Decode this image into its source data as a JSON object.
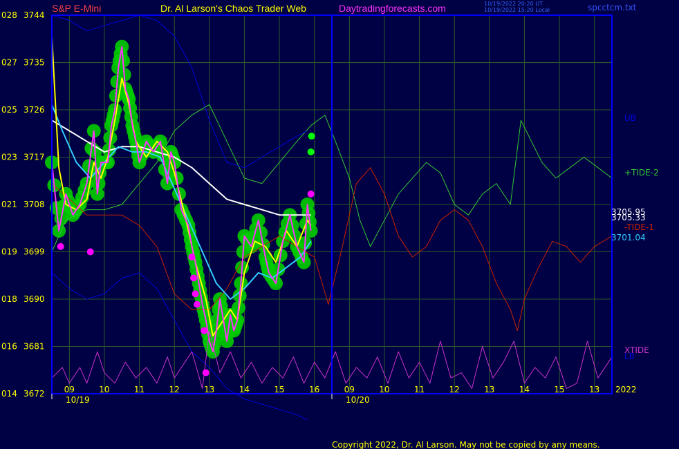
{
  "header": {
    "instrument": "S&P E-Mini",
    "site": "Dr. Al Larson's Chaos Trader Web",
    "url": "Daytradingforecasts.com",
    "timestamp_ut": "10/19/2022 20:20 UT",
    "timestamp_local": "10/19/2022 15:20 Local",
    "file": "spcctcm.txt"
  },
  "copyright": "Copyright 2022, Dr. Al Larson. May not be copied by any means.",
  "colors": {
    "background": "#000044",
    "plot_border": "#0000FF",
    "grid": "#2B5A2B",
    "price": "#FF33FF",
    "ma_fast": "#FFFF00",
    "ma_mid": "#33CCFF",
    "ma_slow": "#FFFFFF",
    "tide_plus": "#33CC33",
    "tide_minus": "#CC2200",
    "bands": "#0000DD",
    "xtide": "#CC33CC",
    "bubble": "#00CC00"
  },
  "chart_data": {
    "type": "line",
    "title": "S&P E-Mini",
    "y_ticks": [
      {
        "left": "028",
        "right": "3744"
      },
      {
        "left": "027",
        "right": "3735"
      },
      {
        "left": "025",
        "right": "3726"
      },
      {
        "left": "023",
        "right": "3717"
      },
      {
        "left": "021",
        "right": "3708"
      },
      {
        "left": "019",
        "right": "3699"
      },
      {
        "left": "018",
        "right": "3690"
      },
      {
        "left": "016",
        "right": "3681"
      },
      {
        "left": "014",
        "right": "3672"
      }
    ],
    "ylim": [
      3672,
      3744
    ],
    "x_hour_labels": [
      "09",
      "10",
      "11",
      "12",
      "13",
      "14",
      "15",
      "16",
      "09",
      "10",
      "11",
      "12",
      "13",
      "14",
      "15",
      "13"
    ],
    "x_date_labels": [
      {
        "label": "10/19",
        "hour": 8.5
      },
      {
        "label": "10/20",
        "hour": 16.5
      }
    ],
    "year_label": "2022",
    "xlim": [
      8.5,
      24.5
    ],
    "grid": true,
    "series": [
      {
        "name": "+TIDE-2",
        "color": "#33CC33",
        "x": [
          8.5,
          8.9,
          9.5,
          10.0,
          10.5,
          11.0,
          11.5,
          12.0,
          12.5,
          13.0,
          13.5,
          14.0,
          14.5,
          15.0,
          15.5,
          15.9,
          16.3,
          16.6,
          17.0,
          17.3,
          17.6,
          18.0,
          18.4,
          18.8,
          19.2,
          19.6,
          20.0,
          20.4,
          20.8,
          21.2,
          21.6,
          21.9,
          22.2,
          22.5,
          22.9,
          23.3,
          23.7,
          24.1,
          24.5
        ],
        "y": [
          3699,
          3705,
          3707,
          3707,
          3708,
          3712,
          3716,
          3722,
          3725,
          3727,
          3720,
          3713,
          3712,
          3716,
          3720,
          3723,
          3725,
          3720,
          3713,
          3705,
          3700,
          3705,
          3710,
          3713,
          3716,
          3714,
          3708,
          3706,
          3710,
          3712,
          3708,
          3724,
          3720,
          3716,
          3713,
          3715,
          3717,
          3715,
          3713
        ]
      },
      {
        "name": "-TIDE-1",
        "color": "#CC2200",
        "x": [
          8.5,
          9.0,
          9.5,
          10.0,
          10.5,
          11.0,
          11.5,
          12.0,
          12.5,
          13.0,
          13.5,
          14.0,
          14.5,
          15.0,
          15.5,
          16.0,
          16.4,
          16.8,
          17.2,
          17.6,
          18.0,
          18.4,
          18.8,
          19.2,
          19.6,
          20.0,
          20.4,
          20.8,
          21.2,
          21.6,
          21.8,
          22.0,
          22.4,
          22.8,
          23.2,
          23.6,
          24.0,
          24.5
        ],
        "y": [
          3712,
          3709,
          3706,
          3706,
          3706,
          3704,
          3700,
          3691,
          3688,
          3688,
          3692,
          3698,
          3700,
          3702,
          3700,
          3698,
          3689,
          3700,
          3712,
          3715,
          3710,
          3702,
          3698,
          3700,
          3705,
          3707,
          3705,
          3700,
          3693,
          3688,
          3684,
          3690,
          3696,
          3701,
          3700,
          3697,
          3700,
          3702
        ]
      },
      {
        "name": "UB",
        "color": "#0000DD",
        "x": [
          8.5,
          9.0,
          9.5,
          10.0,
          10.5,
          11.0,
          11.5,
          12.0,
          12.5,
          13.0,
          13.5,
          14.0,
          14.5,
          15.0,
          15.5,
          15.8
        ],
        "y": [
          3744,
          3743,
          3741,
          3742,
          3743,
          3744,
          3743,
          3740,
          3734,
          3724,
          3716,
          3715,
          3717,
          3719,
          3721,
          3722
        ]
      },
      {
        "name": "LB",
        "color": "#0000DD",
        "x": [
          8.5,
          9.0,
          9.5,
          10.0,
          10.5,
          11.0,
          11.5,
          12.0,
          12.5,
          13.0,
          13.5,
          14.0,
          14.5,
          15.0,
          15.5,
          15.8
        ],
        "y": [
          3695,
          3692,
          3690,
          3691,
          3694,
          3695,
          3692,
          3686,
          3680,
          3677,
          3673,
          3671,
          3670,
          3669,
          3668,
          3667
        ]
      },
      {
        "name": "3705.95",
        "color": "#FFFFFF",
        "x": [
          8.5,
          9.0,
          9.5,
          10.0,
          10.5,
          11.0,
          11.5,
          12.0,
          12.5,
          13.0,
          13.5,
          14.0,
          14.5,
          15.0,
          15.5,
          15.9
        ],
        "y": [
          3724,
          3722,
          3720,
          3718,
          3719,
          3719,
          3718,
          3717,
          3715,
          3712,
          3709,
          3708,
          3707,
          3706,
          3706,
          3706
        ]
      },
      {
        "name": "3701.04",
        "color": "#33CCFF",
        "x": [
          8.5,
          8.8,
          9.2,
          9.6,
          10.0,
          10.4,
          10.8,
          11.2,
          11.6,
          12.0,
          12.4,
          12.8,
          13.2,
          13.6,
          14.0,
          14.4,
          14.8,
          15.2,
          15.6,
          15.9
        ],
        "y": [
          3727,
          3722,
          3716,
          3713,
          3716,
          3719,
          3718,
          3718,
          3717,
          3711,
          3705,
          3699,
          3693,
          3690,
          3692,
          3695,
          3694,
          3696,
          3698,
          3701
        ]
      },
      {
        "name": "Fast MA",
        "color": "#FFFF00",
        "x": [
          8.5,
          8.7,
          8.9,
          9.2,
          9.5,
          9.7,
          9.9,
          10.1,
          10.3,
          10.5,
          10.7,
          10.9,
          11.2,
          11.5,
          11.8,
          12.0,
          12.3,
          12.6,
          12.9,
          13.1,
          13.3,
          13.6,
          13.8,
          14.0,
          14.3,
          14.6,
          14.9,
          15.2,
          15.5,
          15.8,
          15.9
        ],
        "y": [
          3740,
          3715,
          3708,
          3707,
          3709,
          3716,
          3713,
          3717,
          3724,
          3732,
          3727,
          3720,
          3717,
          3720,
          3718,
          3714,
          3706,
          3697,
          3690,
          3683,
          3685,
          3688,
          3686,
          3695,
          3701,
          3700,
          3697,
          3703,
          3700,
          3705,
          3704
        ]
      },
      {
        "name": "Price",
        "color": "#FF33FF",
        "x": [
          8.5,
          8.7,
          8.9,
          9.1,
          9.3,
          9.5,
          9.7,
          9.8,
          9.9,
          10.1,
          10.2,
          10.3,
          10.4,
          10.5,
          10.6,
          10.7,
          10.8,
          10.9,
          11.0,
          11.2,
          11.4,
          11.6,
          11.8,
          11.9,
          12.0,
          12.2,
          12.4,
          12.5,
          12.6,
          12.7,
          12.8,
          12.9,
          13.0,
          13.1,
          13.2,
          13.3,
          13.4,
          13.5,
          13.6,
          13.7,
          13.8,
          13.9,
          14.0,
          14.2,
          14.4,
          14.6,
          14.7,
          14.9,
          15.1,
          15.3,
          15.5,
          15.7,
          15.8,
          15.9
        ],
        "y": [
          3716,
          3703,
          3710,
          3706,
          3708,
          3712,
          3722,
          3710,
          3716,
          3716,
          3723,
          3726,
          3734,
          3738,
          3730,
          3728,
          3723,
          3720,
          3716,
          3720,
          3718,
          3720,
          3712,
          3718,
          3716,
          3707,
          3704,
          3700,
          3697,
          3693,
          3689,
          3686,
          3682,
          3680,
          3684,
          3690,
          3686,
          3682,
          3687,
          3684,
          3686,
          3693,
          3702,
          3700,
          3705,
          3698,
          3695,
          3693,
          3701,
          3706,
          3700,
          3697,
          3708,
          3703
        ]
      },
      {
        "name": "XTIDE",
        "color": "#CC33CC",
        "x": [
          8.5,
          8.8,
          9.0,
          9.3,
          9.5,
          9.8,
          10.0,
          10.3,
          10.6,
          10.9,
          11.2,
          11.5,
          11.8,
          12.0,
          12.3,
          12.5,
          12.8,
          13.0,
          13.3,
          13.6,
          13.9,
          14.2,
          14.5,
          14.8,
          15.1,
          15.4,
          15.7,
          16.0,
          16.3,
          16.6,
          16.9,
          17.2,
          17.5,
          17.8,
          18.1,
          18.4,
          18.7,
          19.0,
          19.3,
          19.6,
          19.9,
          20.2,
          20.5,
          20.8,
          21.1,
          21.4,
          21.7,
          22.0,
          22.3,
          22.6,
          22.9,
          23.2,
          23.5,
          23.8,
          24.1,
          24.5
        ],
        "y": [
          3675,
          3677,
          3674,
          3677,
          3674,
          3680,
          3676,
          3674,
          3678,
          3675,
          3677,
          3674,
          3679,
          3675,
          3678,
          3680,
          3673,
          3684,
          3676,
          3680,
          3675,
          3678,
          3674,
          3677,
          3675,
          3679,
          3674,
          3678,
          3675,
          3680,
          3674,
          3677,
          3675,
          3679,
          3674,
          3680,
          3675,
          3678,
          3674,
          3682,
          3675,
          3676,
          3673,
          3681,
          3675,
          3678,
          3682,
          3674,
          3677,
          3675,
          3679,
          3673,
          3674,
          3682,
          3675,
          3679
        ]
      }
    ],
    "series_labels": [
      {
        "text": "UB",
        "color": "#0000DD"
      },
      {
        "text": "+TIDE-2",
        "color": "#33CC33"
      },
      {
        "text": "3705.95",
        "color": "#FFFFFF"
      },
      {
        "text": "3705.33",
        "color": "#FFFFFF"
      },
      {
        "text": "-TIDE-1",
        "color": "#CC2200"
      },
      {
        "text": "3701.04",
        "color": "#33CCFF"
      },
      {
        "text": "XTIDE",
        "color": "#CC33CC"
      },
      {
        "text": "LB",
        "color": "#0000DD"
      }
    ],
    "markers": [
      {
        "hour": 8.75,
        "value": 3700,
        "color": "#FF00FF"
      },
      {
        "hour": 9.6,
        "value": 3699,
        "color": "#FF00FF"
      },
      {
        "hour": 12.5,
        "value": 3698,
        "color": "#FF00FF"
      },
      {
        "hour": 12.55,
        "value": 3694,
        "color": "#FF00FF"
      },
      {
        "hour": 12.6,
        "value": 3691,
        "color": "#FF00FF"
      },
      {
        "hour": 12.65,
        "value": 3689,
        "color": "#FF00FF"
      },
      {
        "hour": 12.85,
        "value": 3684,
        "color": "#FF00FF"
      },
      {
        "hour": 12.9,
        "value": 3676,
        "color": "#FF00FF"
      },
      {
        "hour": 15.9,
        "value": 3718,
        "color": "#00FF00"
      },
      {
        "hour": 15.92,
        "value": 3721,
        "color": "#00FF00"
      },
      {
        "hour": 15.9,
        "value": 3710,
        "color": "#FF00FF"
      }
    ]
  }
}
